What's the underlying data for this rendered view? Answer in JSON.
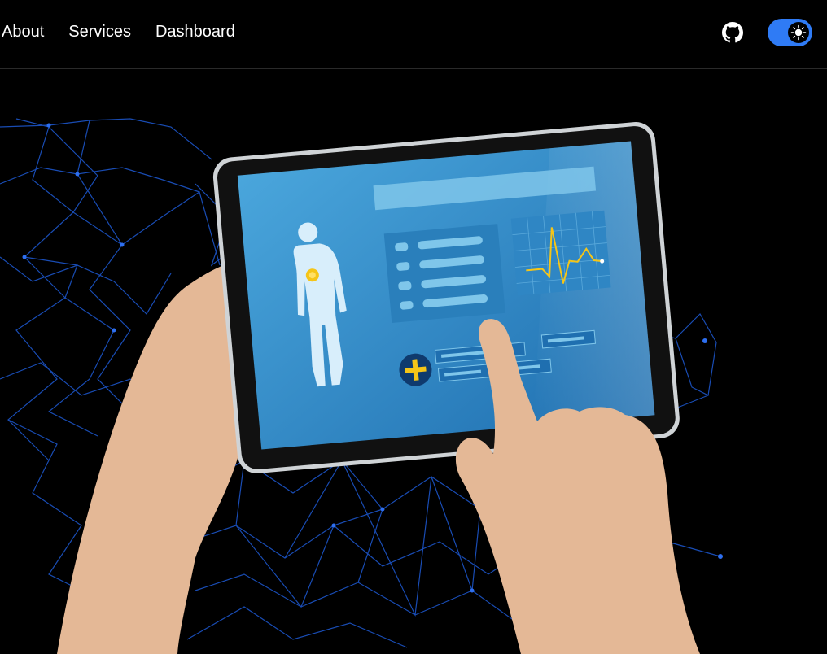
{
  "nav": {
    "links": [
      "About",
      "Services",
      "Dashboard"
    ]
  },
  "header": {
    "github_icon": "github-icon",
    "theme_toggle_icon": "sun-icon",
    "toggle_color": "#2f7bf5"
  },
  "hero": {
    "illustration": "hands-holding-medical-tablet"
  }
}
